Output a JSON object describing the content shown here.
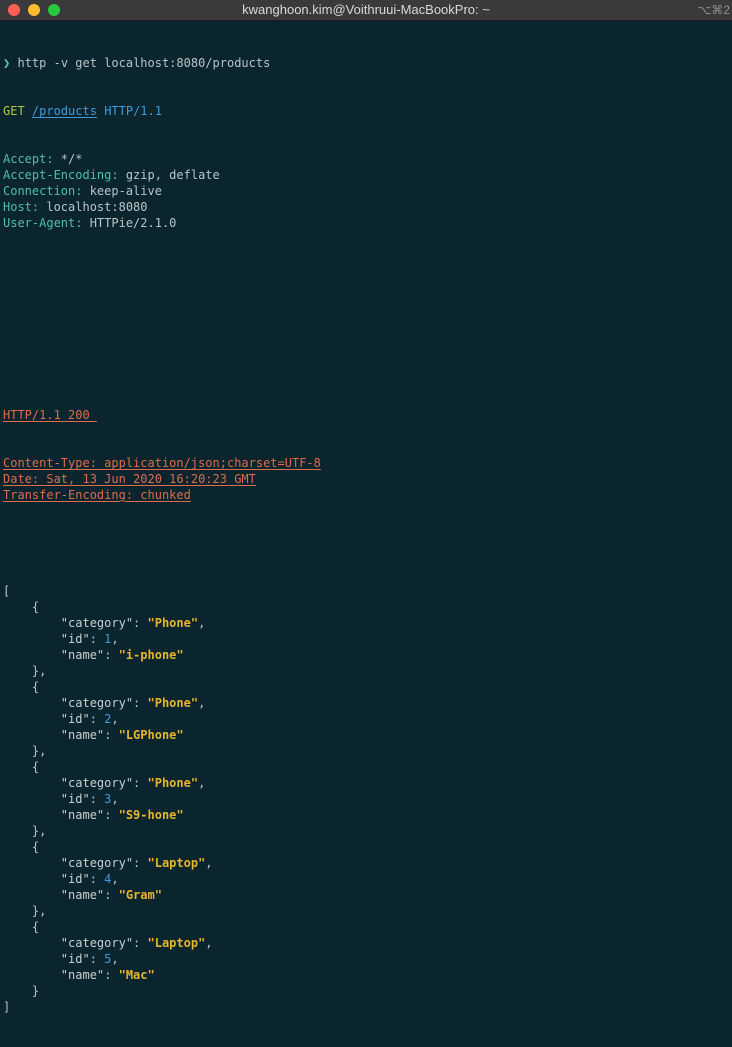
{
  "window": {
    "title": "kwanghoon.kim@Voithruui-MacBookPro: ~",
    "shortcut": "⌥⌘2"
  },
  "command": {
    "prompt": "❯",
    "text": "http -v get localhost:8080/products"
  },
  "request": {
    "method": "GET",
    "path": "/products",
    "protocol": "HTTP/1.1",
    "headers": [
      {
        "name": "Accept:",
        "value": " */*"
      },
      {
        "name": "Accept-Encoding:",
        "value": " gzip, deflate"
      },
      {
        "name": "Connection:",
        "value": " keep-alive"
      },
      {
        "name": "Host:",
        "value": " localhost:8080"
      },
      {
        "name": "User-Agent:",
        "value": " HTTPie/2.1.0"
      }
    ]
  },
  "response": {
    "status": "HTTP/1.1 200 ",
    "headers": [
      "Content-Type: application/json;charset=UTF-8",
      "Date: Sat, 13 Jun 2020 16:20:23 GMT",
      "Transfer-Encoding: chunked"
    ]
  },
  "body": {
    "open_bracket": "[",
    "close_bracket": "]",
    "key_category": "\"category\"",
    "key_id": "\"id\"",
    "key_name": "\"name\"",
    "items": [
      {
        "category": "\"Phone\"",
        "id": "1",
        "name": "\"i-phone\""
      },
      {
        "category": "\"Phone\"",
        "id": "2",
        "name": "\"LGPhone\""
      },
      {
        "category": "\"Phone\"",
        "id": "3",
        "name": "\"S9-hone\""
      },
      {
        "category": "\"Laptop\"",
        "id": "4",
        "name": "\"Gram\""
      },
      {
        "category": "\"Laptop\"",
        "id": "5",
        "name": "\"Mac\""
      }
    ]
  },
  "colors": {
    "background": "#0b252f",
    "prompt": "#52d0b3",
    "method": "#afca3f",
    "protocol": "#3d9cd9",
    "header_name": "#4fbfa5",
    "response": "#dd6b4c",
    "json_string": "#e6b52e",
    "json_number": "#3d9cd9"
  }
}
